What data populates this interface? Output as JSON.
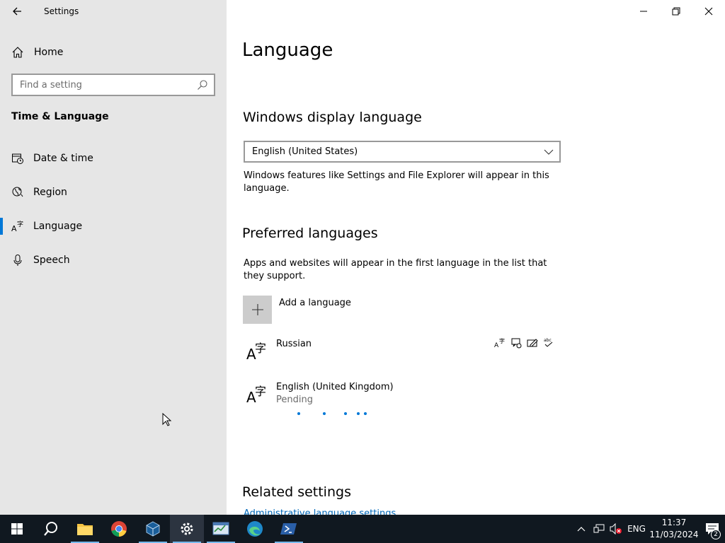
{
  "window": {
    "title": "Settings"
  },
  "sidebar": {
    "home_label": "Home",
    "search_placeholder": "Find a setting",
    "section_heading": "Time & Language",
    "items": [
      {
        "label": "Date & time",
        "icon": "calendar-clock-icon",
        "active": false
      },
      {
        "label": "Region",
        "icon": "globe-icon",
        "active": false
      },
      {
        "label": "Language",
        "icon": "language-icon",
        "active": true
      },
      {
        "label": "Speech",
        "icon": "microphone-icon",
        "active": false
      }
    ]
  },
  "main": {
    "page_title": "Language",
    "display_language": {
      "heading": "Windows display language",
      "selected": "English (United States)",
      "description": "Windows features like Settings and File Explorer will appear in this language."
    },
    "preferred": {
      "heading": "Preferred languages",
      "description": "Apps and websites will appear in the first language in the list that they support.",
      "add_label": "Add a language",
      "languages": [
        {
          "name": "Russian",
          "status": "",
          "feature_icons": [
            "display-language-icon",
            "speech-icon",
            "handwriting-icon",
            "spellcheck-icon"
          ]
        },
        {
          "name": "English (United Kingdom)",
          "status": "Pending"
        }
      ]
    },
    "related": {
      "heading": "Related settings",
      "link": "Administrative language settings"
    }
  },
  "taskbar": {
    "apps": [
      "start-icon",
      "search-icon",
      "file-explorer-icon",
      "chrome-icon",
      "virtualbox-icon",
      "settings-icon",
      "task-manager-icon",
      "edge-icon",
      "powershell-icon"
    ],
    "language": "ENG",
    "time": "11:37",
    "date": "11/03/2024",
    "notifications": "2"
  },
  "accent_color": "#0078d7"
}
